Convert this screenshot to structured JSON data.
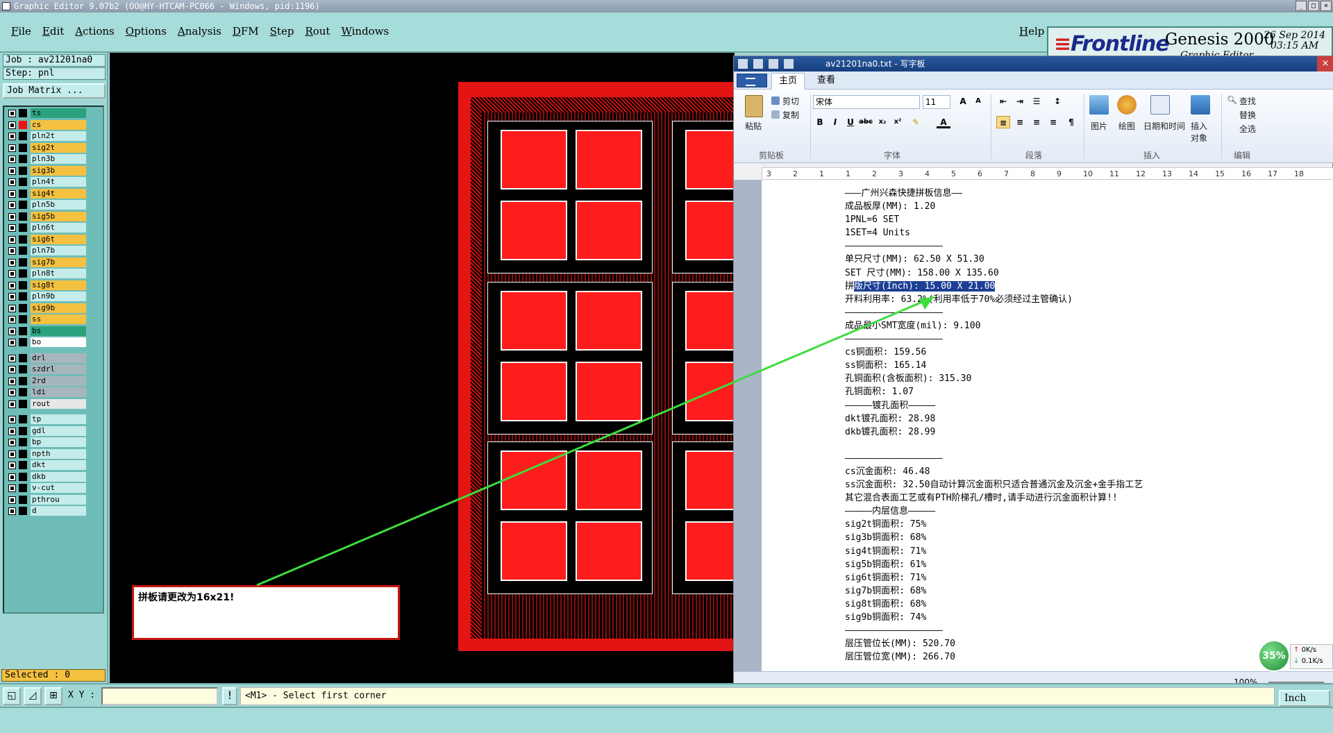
{
  "titlebar": {
    "text": "Graphic Editor 9.07b2 (OO@HY-HTCAM-PC066 - Windows, pid:1196)"
  },
  "menu": {
    "items": [
      "File",
      "Edit",
      "Actions",
      "Options",
      "Analysis",
      "DFM",
      "Step",
      "Rout",
      "Windows"
    ],
    "help": "Help"
  },
  "brand": {
    "logo": "Frontline",
    "product": "Genesis 2000",
    "subtitle": "Graphic Editor",
    "date": "26 Sep 2014",
    "time": "03:15 AM"
  },
  "left_panel": {
    "job": "Job : av21201na0",
    "step": "Step: pnl",
    "job_matrix": "Job Matrix ...",
    "selected": "Selected : 0",
    "layers": [
      {
        "name": "ts",
        "color": "#2aa37d",
        "sq": "#000"
      },
      {
        "name": "cs",
        "color": "#f4c141",
        "sq": "#e11"
      },
      {
        "name": "pln2t",
        "color": "#c4ecea",
        "sq": "#000"
      },
      {
        "name": "sig2t",
        "color": "#f4c141",
        "sq": "#000"
      },
      {
        "name": "pln3b",
        "color": "#c4ecea",
        "sq": "#000"
      },
      {
        "name": "sig3b",
        "color": "#f4c141",
        "sq": "#000"
      },
      {
        "name": "pln4t",
        "color": "#c4ecea",
        "sq": "#000"
      },
      {
        "name": "sig4t",
        "color": "#f4c141",
        "sq": "#000"
      },
      {
        "name": "pln5b",
        "color": "#c4ecea",
        "sq": "#000"
      },
      {
        "name": "sig5b",
        "color": "#f4c141",
        "sq": "#000"
      },
      {
        "name": "pln6t",
        "color": "#c4ecea",
        "sq": "#000"
      },
      {
        "name": "sig6t",
        "color": "#f4c141",
        "sq": "#000"
      },
      {
        "name": "pln7b",
        "color": "#c4ecea",
        "sq": "#000"
      },
      {
        "name": "sig7b",
        "color": "#f4c141",
        "sq": "#000"
      },
      {
        "name": "pln8t",
        "color": "#c4ecea",
        "sq": "#000"
      },
      {
        "name": "sig8t",
        "color": "#f4c141",
        "sq": "#000"
      },
      {
        "name": "pln9b",
        "color": "#c4ecea",
        "sq": "#000"
      },
      {
        "name": "sig9b",
        "color": "#f4c141",
        "sq": "#000"
      },
      {
        "name": "ss",
        "color": "#f4c141",
        "sq": "#000"
      },
      {
        "name": "bs",
        "color": "#2aa37d",
        "sq": "#000"
      },
      {
        "name": "bo",
        "color": "#ffffff",
        "sq": "#000"
      },
      {
        "name": "drl",
        "color": "#a7b6bc",
        "sq": "#000"
      },
      {
        "name": "szdrl",
        "color": "#a7b6bc",
        "sq": "#000"
      },
      {
        "name": "2rd",
        "color": "#a7b6bc",
        "sq": "#000"
      },
      {
        "name": "ldi",
        "color": "#a7b6bc",
        "sq": "#000"
      },
      {
        "name": "rout",
        "color": "#e6e6e6",
        "sq": "#000"
      },
      {
        "name": "tp",
        "color": "#c4ecea",
        "sq": "#000"
      },
      {
        "name": "gdl",
        "color": "#c4ecea",
        "sq": "#000"
      },
      {
        "name": "bp",
        "color": "#c4ecea",
        "sq": "#000"
      },
      {
        "name": "npth",
        "color": "#c4ecea",
        "sq": "#000"
      },
      {
        "name": "dkt",
        "color": "#c4ecea",
        "sq": "#000"
      },
      {
        "name": "dkb",
        "color": "#c4ecea",
        "sq": "#000"
      },
      {
        "name": "v-cut",
        "color": "#c4ecea",
        "sq": "#000"
      },
      {
        "name": "pthrou",
        "color": "#c4ecea",
        "sq": "#000"
      },
      {
        "name": "d",
        "color": "#c4ecea",
        "sq": "#000"
      }
    ]
  },
  "statusbar": {
    "xy_label": "X Y :",
    "prompt": "<M1> - Select first corner",
    "units": "Inch"
  },
  "note": {
    "text": "拼板请更改为16x21!"
  },
  "wordpad": {
    "title": "av21201na0.txt - 写字板",
    "tabs": [
      "主页",
      "查看"
    ],
    "clipboard": {
      "paste": "粘贴",
      "cut": "剪切",
      "copy": "复制",
      "group": "剪贴板"
    },
    "font": {
      "name": "宋体",
      "size": "11",
      "group": "字体"
    },
    "paragraph": {
      "group": "段落"
    },
    "insert": {
      "picture": "图片",
      "paint": "绘图",
      "datetime": "日期和时间",
      "object": "插入对象",
      "group": "插入"
    },
    "edit": {
      "find": "查找",
      "replace": "替换",
      "selectall": "全选",
      "group": "编辑"
    },
    "zoom": "100%",
    "ruler": [
      "3",
      "2",
      "1",
      "1",
      "2",
      "3",
      "4",
      "5",
      "6",
      "7",
      "8",
      "9",
      "10",
      "11",
      "12",
      "13",
      "14",
      "15",
      "16",
      "17",
      "18"
    ],
    "lines": [
      "———广州兴森快捷拼板信息——",
      "成品板厚(MM): 1.20",
      "1PNL=6 SET",
      "1SET=4 Units",
      "——————————————————",
      "单只尺寸(MM): 62.50 X 51.30",
      "SET 尺寸(MM): 158.00 X 135.60",
      "拼版尺寸(Inch): 15.00 X 21.00",
      "开料利用率: 63.2%(利用率低于70%必须经过主管确认)",
      "——————————————————",
      "成品最小SMT宽度(mil): 9.100",
      "——————————————————",
      "cs铜面积: 159.56",
      "ss铜面积: 165.14",
      "孔铜面积(含板面积): 315.30",
      "孔铜面积: 1.07",
      "—————镀孔面积—————",
      "dkt镀孔面积: 28.98",
      "dkb镀孔面积: 28.99",
      "",
      "——————————————————",
      "cs沉金面积: 46.48",
      "ss沉金面积: 32.50自动计算沉金面积只适合普通沉金及沉金+金手指工艺",
      "其它混合表面工艺或有PTH阶梯孔/槽时,请手动进行沉金面积计算!!",
      "—————内层信息—————",
      "sig2t铜面积: 75%",
      "sig3b铜面积: 68%",
      "sig4t铜面积: 71%",
      "sig5b铜面积: 61%",
      "sig6t铜面积: 71%",
      "sig7b铜面积: 68%",
      "sig8t铜面积: 68%",
      "sig9b铜面积: 74%",
      "——————————————————",
      "层压管位长(MM): 520.70",
      "层压管位宽(MM): 266.70"
    ]
  },
  "net_gauge": {
    "percent": "35%",
    "up": "0K/s",
    "down": "0.1K/s"
  }
}
